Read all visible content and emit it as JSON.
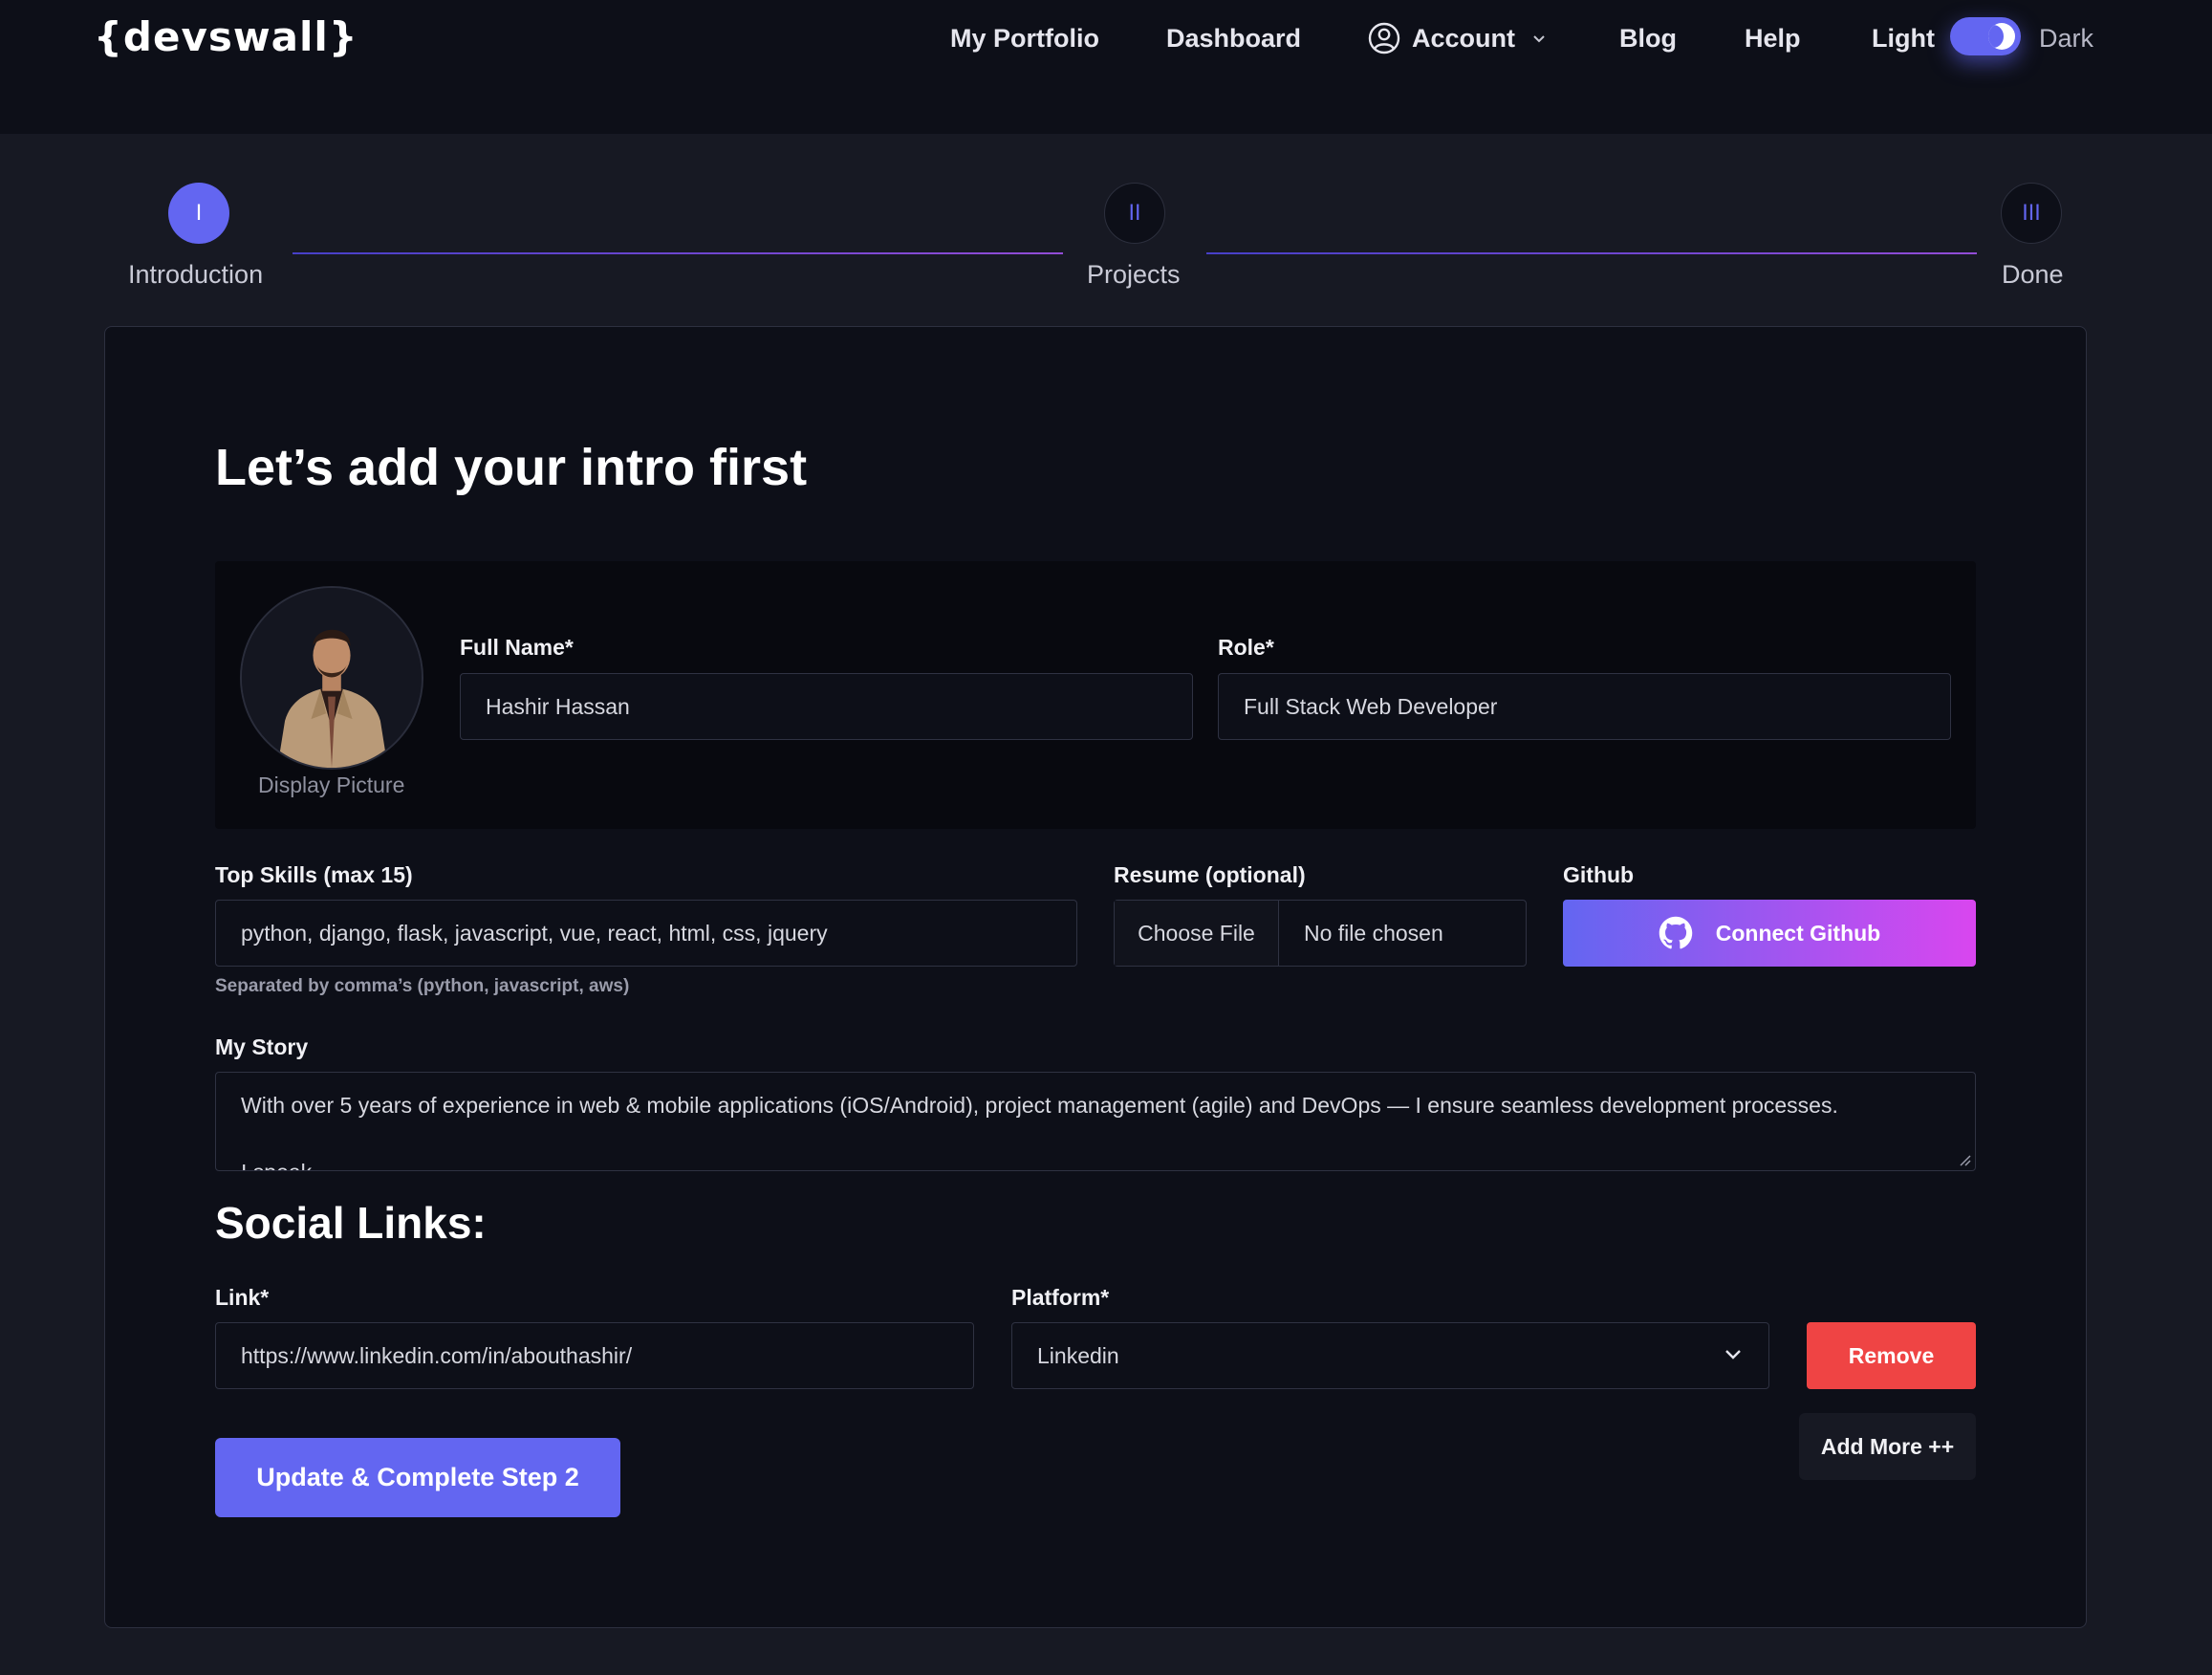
{
  "nav": {
    "logo": "{devswall}",
    "items": {
      "portfolio": "My Portfolio",
      "dashboard": "Dashboard",
      "account": "Account",
      "blog": "Blog",
      "help": "Help"
    },
    "theme": {
      "light_label": "Light",
      "dark_label": "Dark",
      "dark_enabled": true
    }
  },
  "stepper": {
    "steps": [
      {
        "numeral": "I",
        "label": "Introduction",
        "active": true
      },
      {
        "numeral": "II",
        "label": "Projects",
        "active": false
      },
      {
        "numeral": "III",
        "label": "Done",
        "active": false
      }
    ]
  },
  "form": {
    "title": "Let’s add your intro first",
    "display_picture_label": "Display Picture",
    "full_name": {
      "label": "Full Name*",
      "value": "Hashir Hassan"
    },
    "role": {
      "label": "Role*",
      "value": "Full Stack Web Developer"
    },
    "skills": {
      "label": "Top Skills (max 15)",
      "value": "python, django, flask, javascript, vue, react, html, css, jquery",
      "hint": "Separated by comma’s (python, javascript, aws)"
    },
    "resume": {
      "label": "Resume (optional)",
      "button": "Choose File",
      "status": "No file chosen"
    },
    "github": {
      "label": "Github",
      "button": "Connect Github"
    },
    "story": {
      "label": "My Story",
      "line1": "With over 5 years of experience in web & mobile applications (iOS/Android), project management (agile) and DevOps — I ensure seamless development processes.",
      "line2": "I speak"
    }
  },
  "social": {
    "title": "Social Links:",
    "link": {
      "label": "Link*",
      "value": "https://www.linkedin.com/in/abouthashir/"
    },
    "platform": {
      "label": "Platform*",
      "value": "Linkedin"
    },
    "remove_label": "Remove",
    "add_more_label": "Add More ++"
  },
  "submit_label": "Update & Complete Step 2",
  "colors": {
    "accent": "#6366f1",
    "danger": "#ef4444",
    "gradient_end": "#d946ef",
    "background": "#171923",
    "surface": "#0d0f18"
  }
}
